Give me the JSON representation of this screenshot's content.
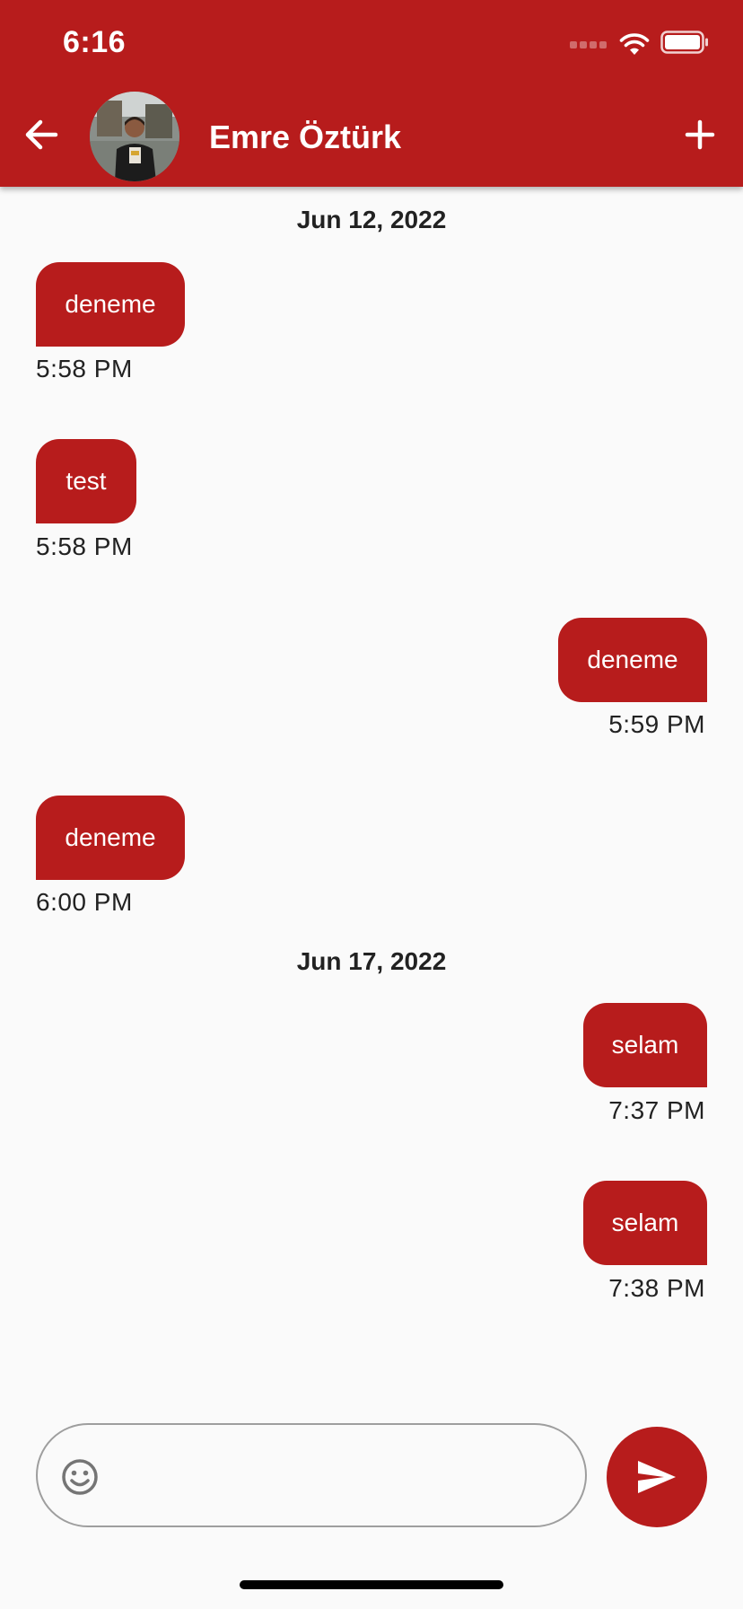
{
  "status_bar": {
    "time": "6:16"
  },
  "header": {
    "contact_name": "Emre Öztürk"
  },
  "icons": {
    "back": "back-arrow-icon",
    "add": "plus-icon",
    "emoji": "emoji-icon",
    "send": "send-icon",
    "wifi": "wifi-icon",
    "battery": "battery-icon"
  },
  "colors": {
    "accent": "#b71c1c",
    "background": "#fafafa",
    "text": "#222222"
  },
  "messages": {
    "date_1": "Jun 12, 2022",
    "m1": {
      "text": "deneme",
      "time": "5:58 PM",
      "direction": "incoming"
    },
    "m2": {
      "text": "test",
      "time": "5:58 PM",
      "direction": "incoming"
    },
    "m3": {
      "text": "deneme",
      "time": "5:59 PM",
      "direction": "outgoing"
    },
    "m4": {
      "text": "deneme",
      "time": "6:00 PM",
      "direction": "incoming"
    },
    "date_2": "Jun 17, 2022",
    "m5": {
      "text": "selam",
      "time": "7:37 PM",
      "direction": "outgoing"
    },
    "m6": {
      "text": "selam",
      "time": "7:38 PM",
      "direction": "outgoing"
    }
  },
  "composer": {
    "placeholder": "",
    "value": ""
  }
}
